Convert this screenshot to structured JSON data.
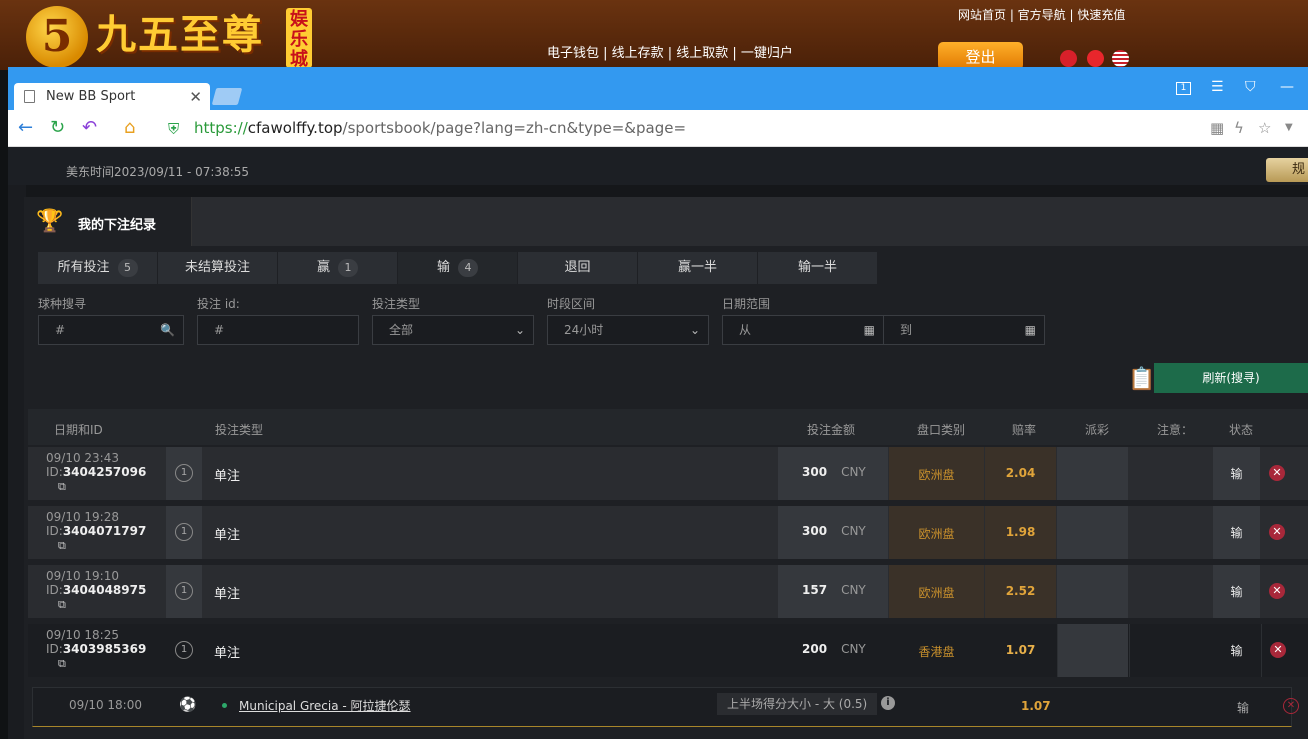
{
  "site": {
    "logo_number": "5",
    "logo_text": "九五至尊",
    "logo_badge": "娱乐城",
    "top_links": "网站首页 | 官方导航 | 快速充值",
    "mid_links": "电子钱包 | 线上存款 | 线上取款 | 一键归户",
    "logout": "登出"
  },
  "browser": {
    "tab_title": "New BB Sport",
    "url_proto": "https://",
    "url_host": "cfawolffy.top",
    "url_path": "/sportsbook/page?lang=zh-cn&type=&page="
  },
  "page": {
    "time": "美东时间2023/09/11 - 07:38:55",
    "rules_button": "规则"
  },
  "modal": {
    "title": "我的下注纪录",
    "filter_tabs": [
      {
        "label": "所有投注",
        "count": "5"
      },
      {
        "label": "未结算投注",
        "count": ""
      },
      {
        "label": "赢",
        "count": "1"
      },
      {
        "label": "输",
        "count": "4"
      },
      {
        "label": "退回",
        "count": ""
      },
      {
        "label": "赢一半",
        "count": ""
      },
      {
        "label": "输一半",
        "count": ""
      }
    ],
    "fields": {
      "sport_label": "球种搜寻",
      "sport_placeholder": "#",
      "betid_label": "投注 id:",
      "betid_placeholder": "#",
      "bettype_label": "投注类型",
      "bettype_value": "全部",
      "period_label": "时段区间",
      "period_value": "24小时",
      "date_label": "日期范围",
      "date_from": "从",
      "date_to": "到"
    },
    "refresh_button": "刷新(搜寻)",
    "columns": {
      "date_id": "日期和ID",
      "bet_type": "投注类型",
      "amount": "投注金额",
      "market": "盘口类别",
      "odds": "赔率",
      "payout": "派彩",
      "note": "注意：",
      "status": "状态"
    },
    "rows": [
      {
        "date": "09/10 23:43",
        "id_prefix": "ID:",
        "id": "3404257096",
        "num": "1",
        "type": "单注",
        "amount": "300",
        "currency": "CNY",
        "market": "欧洲盘",
        "odds": "2.04",
        "status": "输"
      },
      {
        "date": "09/10 19:28",
        "id_prefix": "ID:",
        "id": "3404071797",
        "num": "1",
        "type": "单注",
        "amount": "300",
        "currency": "CNY",
        "market": "欧洲盘",
        "odds": "1.98",
        "status": "输"
      },
      {
        "date": "09/10 19:10",
        "id_prefix": "ID:",
        "id": "3404048975",
        "num": "1",
        "type": "单注",
        "amount": "157",
        "currency": "CNY",
        "market": "欧洲盘",
        "odds": "2.52",
        "status": "输"
      },
      {
        "date": "09/10 18:25",
        "id_prefix": "ID:",
        "id": "3403985369",
        "num": "1",
        "type": "单注",
        "amount": "200",
        "currency": "CNY",
        "market": "香港盘",
        "odds": "1.07",
        "status": "输"
      }
    ],
    "sub_row": {
      "date": "09/10 18:00",
      "match": "Municipal Grecia - 阿拉捷伦瑟",
      "bet_desc": "上半场得分大小 - 大 (0.5)",
      "odds": "1.07",
      "status": "输"
    }
  }
}
